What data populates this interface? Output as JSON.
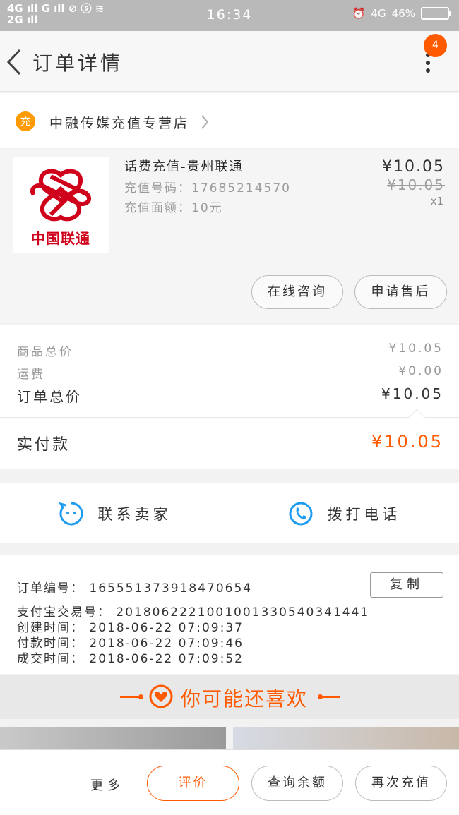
{
  "status_bar": {
    "network_top": "4G",
    "network_bottom": "2G",
    "g_label": "G",
    "time": "16:34",
    "network_right": "4G",
    "battery": "46%"
  },
  "nav": {
    "title": "订单详情",
    "badge_count": "4"
  },
  "shop": {
    "icon_text": "充",
    "name": "中融传媒充值专营店"
  },
  "item": {
    "logo_text": "中国联通",
    "title": "话费充值-贵州联通",
    "phone": "充值号码：17685214570",
    "amount": "充值面额：10元",
    "price": "¥10.05",
    "original_price": "¥10.05",
    "quantity": "x1",
    "consult_label": "在线咨询",
    "aftersale_label": "申请售后"
  },
  "summary": {
    "goods_total_label": "商品总价",
    "goods_total_value": "¥10.05",
    "shipping_label": "运费",
    "shipping_value": "¥0.00",
    "order_total_label": "订单总价",
    "order_total_value": "¥10.05",
    "paid_label": "实付款",
    "paid_value": "¥10.05"
  },
  "contact": {
    "seller_label": "联系卖家",
    "call_label": "拨打电话"
  },
  "order_info": {
    "order_no": "订单编号：  1655513739184706​54",
    "alipay_no": "支付宝交易号：  2018062221001001330540341441",
    "created": "创建时间：  2018-06-22  07:09:37",
    "paid": "付款时间：  2018-06-22  07:09:46",
    "completed": "成交时间：  2018-06-22  07:09:52",
    "copy_label": "复制"
  },
  "recommend": {
    "title": "你可能还喜欢"
  },
  "bottom": {
    "more_label": "更多",
    "review_label": "评价",
    "balance_label": "查询余额",
    "recharge_label": "再次充值"
  },
  "colors": {
    "accent": "#ff5a00",
    "blue": "#1e9cf0",
    "unicom_red": "#d0021b"
  }
}
